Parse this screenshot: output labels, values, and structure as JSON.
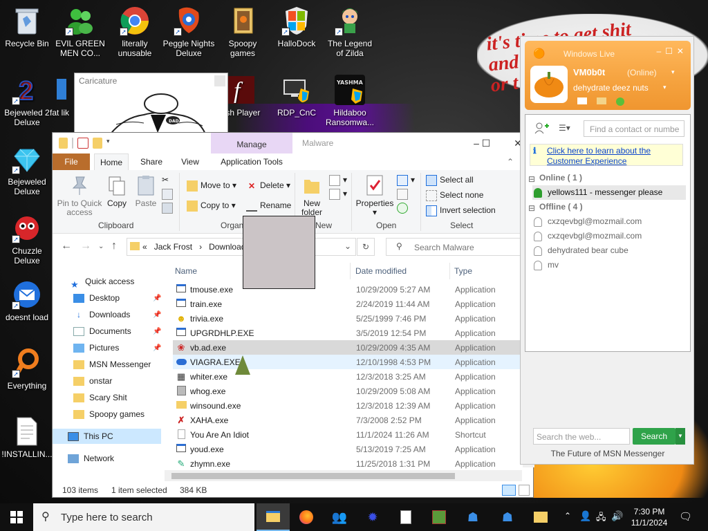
{
  "wallpaper": {
    "slogan": "it's time to get shit\nand\nor t"
  },
  "desktop_icons": [
    {
      "label": "Recycle Bin",
      "icon": "recycle-bin-icon"
    },
    {
      "label": "EVIL GREEN MEN CO...",
      "icon": "msn-buddies-icon"
    },
    {
      "label": "literally unusable",
      "icon": "chrome-icon"
    },
    {
      "label": "Peggle Nights Deluxe",
      "icon": "peggle-icon"
    },
    {
      "label": "Spoopy games",
      "icon": "folder-icon"
    },
    {
      "label": "HalloDock",
      "icon": "windows-shield-icon"
    },
    {
      "label": "The Legend of Zilda",
      "icon": "zilda-icon"
    },
    {
      "label": "Bejeweled 2 Deluxe",
      "icon": "bejeweled2-icon"
    },
    {
      "label": "fat lik",
      "icon": "app-icon"
    },
    {
      "label": "ash Player",
      "icon": "flash-icon"
    },
    {
      "label": "RDP_CnC",
      "icon": "rdp-icon"
    },
    {
      "label": "Hildaboo Ransomwa...",
      "icon": "yashma-icon"
    },
    {
      "label": "Bejeweled Deluxe",
      "icon": "bejeweled-icon"
    },
    {
      "label": "Chuzzle Deluxe",
      "icon": "chuzzle-icon"
    },
    {
      "label": "doesnt load",
      "icon": "thunderbird-icon"
    },
    {
      "label": "Everything",
      "icon": "everything-icon"
    },
    {
      "label": "!INSTALLIN...",
      "icon": "text-file-icon"
    }
  ],
  "yashma_badge": "YASHMA",
  "caricature": {
    "title": "Caricature",
    "sign": "DAD"
  },
  "explorer": {
    "title": "Malware",
    "manage_tab": "Manage",
    "tabs": {
      "file": "File",
      "home": "Home",
      "share": "Share",
      "view": "View",
      "app_tools": "Application Tools"
    },
    "ribbon": {
      "pin": "Pin to Quick access",
      "copy": "Copy",
      "paste": "Paste",
      "clipboard": "Clipboard",
      "move_to": "Move to",
      "delete": "Delete",
      "copy_to": "Copy to",
      "rename": "Rename",
      "organize": "Organ",
      "new_folder": "New folder",
      "new": "New",
      "properties": "Properties",
      "open": "Open",
      "select_all": "Select all",
      "select_none": "Select none",
      "invert_selection": "Invert selection",
      "select": "Select"
    },
    "address": {
      "prefix": "«",
      "crumb1": "Jack Frost",
      "sep": "›",
      "crumb2": "Downloads"
    },
    "search_placeholder": "Search Malware",
    "nav": {
      "quick_access": "Quick access",
      "items": [
        "Desktop",
        "Downloads",
        "Documents",
        "Pictures",
        "MSN Messenger",
        "onstar",
        "Scary Shit",
        "Spoopy games"
      ],
      "this_pc": "This PC",
      "network": "Network"
    },
    "columns": {
      "name": "Name",
      "date": "Date modified",
      "type": "Type"
    },
    "files": [
      {
        "name": "tmouse.exe",
        "date": "10/29/2009 5:27 AM",
        "type": "Application",
        "icon": "app-window-icon"
      },
      {
        "name": "train.exe",
        "date": "2/24/2019 11:44 AM",
        "type": "Application",
        "icon": "app-window-icon"
      },
      {
        "name": "trivia.exe",
        "date": "5/25/1999 7:46 PM",
        "type": "Application",
        "icon": "smiley-icon"
      },
      {
        "name": "UPGRDHLP.EXE",
        "date": "3/5/2019 12:54 PM",
        "type": "Application",
        "icon": "app-window-icon"
      },
      {
        "name": "vb.ad.exe",
        "date": "10/29/2009 4:35 AM",
        "type": "Application",
        "icon": "rose-icon"
      },
      {
        "name": "VIAGRA.EXE",
        "date": "12/10/1998 4:53 PM",
        "type": "Application",
        "icon": "pill-icon"
      },
      {
        "name": "whiter.exe",
        "date": "12/3/2018 3:25 AM",
        "type": "Application",
        "icon": "paint-icon"
      },
      {
        "name": "whog.exe",
        "date": "10/29/2009 5:08 AM",
        "type": "Application",
        "icon": "zip-icon"
      },
      {
        "name": "winsound.exe",
        "date": "12/3/2018 12:39 AM",
        "type": "Application",
        "icon": "folder-icon"
      },
      {
        "name": "XAHA.exe",
        "date": "7/3/2008 2:52 PM",
        "type": "Application",
        "icon": "xaha-icon"
      },
      {
        "name": "You Are An Idiot",
        "date": "11/1/2024 11:26 AM",
        "type": "Shortcut",
        "icon": "blank-file-icon"
      },
      {
        "name": "youd.exe",
        "date": "5/13/2019 7:25 AM",
        "type": "Application",
        "icon": "app-window-icon"
      },
      {
        "name": "zhymn.exe",
        "date": "11/25/2018 1:31 PM",
        "type": "Application",
        "icon": "pen-icon"
      }
    ],
    "status": {
      "count": "103 items",
      "selected": "1 item selected",
      "size": "384 KB"
    }
  },
  "msn": {
    "window_title": "Windows Live",
    "display_name": "VM0b0t",
    "status": "(Online)",
    "personal_message": "dehydrate deez nuts",
    "find_placeholder": "Find a contact or numbe",
    "ad_text": "Click here to learn about the Customer Experience",
    "online_header": "Online ( 1 )",
    "online": [
      "yellows111 - messenger please"
    ],
    "offline_header": "Offline ( 4 )",
    "offline": [
      "cxzqevbgl@mozmail.com",
      "cxzqevbgl@mozmail.com",
      "dehydrated bear cube",
      "mv"
    ],
    "search_placeholder": "Search the web...",
    "search_button": "Search",
    "footer": "The Future of MSN Messenger"
  },
  "taskbar": {
    "search_text": "Type here to search",
    "time": "7:30 PM",
    "date": "11/1/2024"
  }
}
